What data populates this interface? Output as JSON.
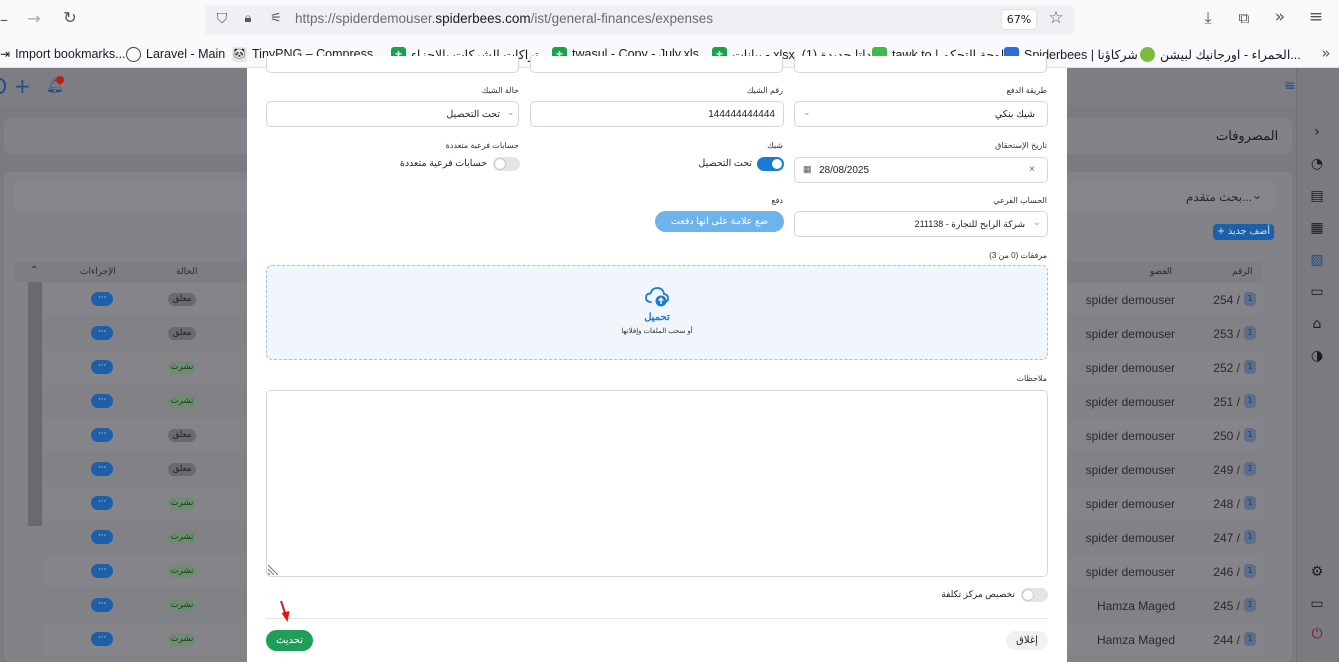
{
  "browser": {
    "url_prefix": "https://spiderdemouser.",
    "url_domain": "spiderbees.com",
    "url_path": "/ist/general-finances/expenses",
    "zoom": "67%"
  },
  "bookmarks": [
    {
      "label": "Import bookmarks..."
    },
    {
      "label": "Laravel - Main"
    },
    {
      "label": "TinyPNG – Compress ..."
    },
    {
      "label": "تراكات الشركات بالاجزاء..."
    },
    {
      "label": "twasul - Copy - July.xls..."
    },
    {
      "label": "بيانات - xlsx. داتا جديدة (1)..."
    },
    {
      "label": "tawk.to | لوحة التحكم"
    },
    {
      "label": "Spiderbees | شركاؤنا"
    },
    {
      "label": "الحمراء - اورجانيك لبيشن..."
    }
  ],
  "page": {
    "title": "المصروفات",
    "advanced_search": "بحث متقدم...",
    "add_new": "+ أضف جديد",
    "columns": {
      "number": "الرقم",
      "member": "العضو",
      "status": "الحالة",
      "actions": "الإجراءات"
    },
    "rows": [
      {
        "id": "254 /",
        "member": "spider demouser",
        "status": "معلق",
        "status_type": "m"
      },
      {
        "id": "253 /",
        "member": "spider demouser",
        "status": "معلق",
        "status_type": "m"
      },
      {
        "id": "252 /",
        "member": "spider demouser",
        "status": "نشرت",
        "status_type": "n"
      },
      {
        "id": "251 /",
        "member": "spider demouser",
        "status": "نشرت",
        "status_type": "n"
      },
      {
        "id": "250 /",
        "member": "spider demouser",
        "status": "معلق",
        "status_type": "m"
      },
      {
        "id": "249 /",
        "member": "spider demouser",
        "status": "معلق",
        "status_type": "m"
      },
      {
        "id": "248 /",
        "member": "spider demouser",
        "status": "نشرت",
        "status_type": "n"
      },
      {
        "id": "247 /",
        "member": "spider demouser",
        "status": "نشرت",
        "status_type": "n"
      },
      {
        "id": "246 /",
        "member": "spider demouser",
        "status": "نشرت",
        "status_type": "n"
      },
      {
        "id": "245 /",
        "member": "Hamza Maged",
        "status": "نشرت",
        "status_type": "n"
      },
      {
        "id": "244 /",
        "member": "Hamza Maged",
        "status": "نشرت",
        "status_type": "n"
      }
    ],
    "row_badge": "1",
    "actions_label": "···"
  },
  "modal": {
    "payment_method_label": "طريقة الدفع",
    "payment_method_value": "شيك بنكي",
    "cheque_number_label": "رقم الشيك",
    "cheque_number_value": "144444444444",
    "cheque_status_label": "حالة الشيك",
    "cheque_status_value": "تحت التحصيل",
    "due_date_label": "تاريخ الإستحقاق",
    "due_date_value": "28/08/2025",
    "cheque_label": "شيك",
    "cheque_toggle_label": "تحت التحصيل",
    "multi_accounts_label": "حسابات فرعية متعددة",
    "multi_accounts_toggle_label": "حسابات فرعية متعددة",
    "sub_account_label": "الحساب الفرعي",
    "sub_account_value": "211138 - شركة الرابح للتجارة",
    "payment_label": "دفع",
    "mark_paid_button": "ضع علامة على انها دفعت",
    "attachments_label": "مرفقات (0 من 3)",
    "upload_label": "تحميل",
    "upload_hint": "أو سحب الملفات وإفلاتها",
    "notes_label": "ملاحظات",
    "cost_center_label": "تخصيص مركز تكلفة",
    "update_button": "تحديث",
    "close_button": "إغلاق"
  },
  "colors": {
    "primary": "#1a7cd4",
    "success": "#1e9e56",
    "badge_light": "#6db3ec"
  }
}
